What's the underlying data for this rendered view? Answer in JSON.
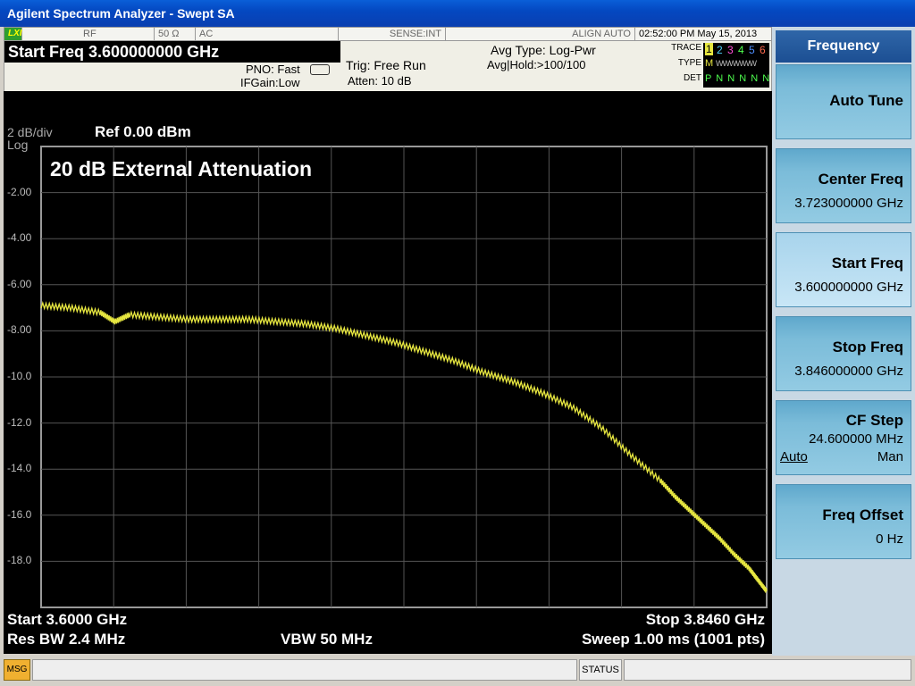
{
  "window": {
    "title": "Agilent Spectrum Analyzer - Swept SA"
  },
  "status_strip": {
    "lxi": "LXI",
    "rf": "RF",
    "impedance": "50 Ω",
    "coupling": "AC",
    "sense": "SENSE:INT",
    "align": "ALIGN AUTO",
    "datetime": "02:52:00 PM May 15, 2013"
  },
  "header": {
    "active_param": "Start Freq  3.600000000 GHz",
    "pno": "PNO: Fast",
    "ifgain": "IFGain:Low",
    "trig": "Trig: Free Run",
    "atten": "Atten: 10 dB",
    "avg_type": "Avg Type: Log-Pwr",
    "avg_hold": "Avg|Hold:>100/100",
    "trace_label": "TRACE",
    "type_label": "TYPE",
    "det_label": "DET",
    "trace_nums": [
      "1",
      "2",
      "3",
      "4",
      "5",
      "6"
    ],
    "trace_type": "M",
    "trace_det": "P N N N N N"
  },
  "screen": {
    "scale": "2 dB/div",
    "log": "Log",
    "ref": "Ref 0.00 dBm",
    "annotation": "20 dB External Attenuation",
    "y_labels": [
      "-2.00",
      "-4.00",
      "-6.00",
      "-8.00",
      "-10.0",
      "-12.0",
      "-14.0",
      "-16.0",
      "-18.0"
    ],
    "start": "Start 3.6000 GHz",
    "stop": "Stop 3.8460 GHz",
    "res_bw": "Res BW 2.4 MHz",
    "vbw": "VBW 50 MHz",
    "sweep": "Sweep  1.00 ms (1001 pts)"
  },
  "chart_data": {
    "type": "line",
    "title": "20 dB External Attenuation",
    "xlabel": "",
    "ylabel": "",
    "x_unit": "GHz",
    "y_unit": "dBm",
    "xlim": [
      3.6,
      3.846
    ],
    "ylim": [
      -20,
      0
    ],
    "grid": true,
    "series": [
      {
        "color": "#e6e640",
        "x": [
          3.6,
          3.61,
          3.62,
          3.625,
          3.63,
          3.64,
          3.65,
          3.66,
          3.67,
          3.68,
          3.69,
          3.7,
          3.71,
          3.72,
          3.73,
          3.74,
          3.75,
          3.76,
          3.77,
          3.78,
          3.79,
          3.8,
          3.81,
          3.815,
          3.82,
          3.825,
          3.83,
          3.835,
          3.84,
          3.843,
          3.846
        ],
        "y": [
          -6.9,
          -7.0,
          -7.2,
          -7.6,
          -7.3,
          -7.4,
          -7.5,
          -7.5,
          -7.5,
          -7.6,
          -7.7,
          -7.9,
          -8.2,
          -8.5,
          -8.9,
          -9.3,
          -9.8,
          -10.2,
          -10.7,
          -11.3,
          -12.2,
          -13.4,
          -14.5,
          -15.2,
          -15.8,
          -16.4,
          -17.0,
          -17.7,
          -18.3,
          -18.8,
          -19.3
        ]
      }
    ]
  },
  "softkeys": {
    "menu_title": "Frequency",
    "auto_tune": "Auto Tune",
    "center_freq": {
      "label": "Center Freq",
      "value": "3.723000000 GHz"
    },
    "start_freq": {
      "label": "Start Freq",
      "value": "3.600000000 GHz"
    },
    "stop_freq": {
      "label": "Stop Freq",
      "value": "3.846000000 GHz"
    },
    "cf_step": {
      "label": "CF Step",
      "value": "24.600000 MHz",
      "auto": "Auto",
      "man": "Man"
    },
    "freq_offset": {
      "label": "Freq Offset",
      "value": "0 Hz"
    }
  },
  "bottom": {
    "msg": "MSG",
    "status": "STATUS"
  }
}
